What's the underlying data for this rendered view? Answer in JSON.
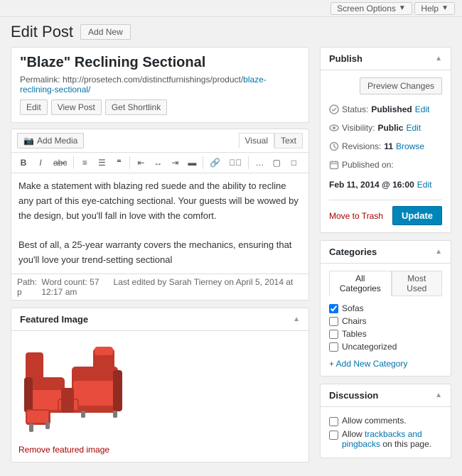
{
  "topBar": {
    "screenOptions": "Screen Options",
    "screenOptionsChevron": "▼",
    "help": "Help",
    "helpChevron": "▼"
  },
  "header": {
    "title": "Edit Post",
    "addNew": "Add New"
  },
  "post": {
    "title": "\"Blaze\" Reclining Sectional",
    "permalinkLabel": "Permalink:",
    "permalinkBase": "http://prosetech.com/distinctfurnishings/product/",
    "permalinkSlug": "blaze-reclining-sectional/",
    "editBtn": "Edit",
    "viewPostBtn": "View Post",
    "getShortlinkBtn": "Get Shortlink"
  },
  "editor": {
    "addMediaBtn": "Add Media",
    "addMediaIcon": "🖼",
    "visualTab": "Visual",
    "textTab": "Text",
    "formatButtons": [
      "B",
      "I",
      "ABC",
      "≡",
      "≡",
      "❝",
      "≡",
      "≡",
      "≡",
      "≡",
      "🔗",
      "🔗✗",
      "⊞",
      "–",
      "⊠",
      "⊟"
    ],
    "content": "Make a statement with blazing red suede and the ability to recline any part of this eye-catching sectional. Your guests will be wowed by the design, but you'll fall in love with the comfort.\n\nBest of all, a 25-year warranty covers the mechanics, ensuring that you'll love your trend-setting sectional",
    "pathLabel": "Path: p",
    "wordCount": "Word count: 57",
    "lastEdited": "Last edited by Sarah Tierney on April 5, 2014 at 12:17 am"
  },
  "featuredImage": {
    "title": "Featured Image",
    "removeLink": "Remove featured image"
  },
  "publish": {
    "title": "Publish",
    "previewBtn": "Preview Changes",
    "statusLabel": "Status:",
    "statusValue": "Published",
    "statusEdit": "Edit",
    "visibilityLabel": "Visibility:",
    "visibilityValue": "Public",
    "visibilityEdit": "Edit",
    "revisionsLabel": "Revisions:",
    "revisionsValue": "11",
    "revisionsLink": "Browse",
    "publishedLabel": "Published on:",
    "publishedValue": "Feb 11, 2014 @ 16:00",
    "publishedEdit": "Edit",
    "moveToTrash": "Move to Trash",
    "updateBtn": "Update"
  },
  "categories": {
    "title": "Categories",
    "allTab": "All Categories",
    "mostUsedTab": "Most Used",
    "items": [
      {
        "label": "Sofas",
        "checked": true
      },
      {
        "label": "Chairs",
        "checked": false
      },
      {
        "label": "Tables",
        "checked": false
      },
      {
        "label": "Uncategorized",
        "checked": false
      }
    ],
    "addNewLink": "+ Add New Category"
  },
  "discussion": {
    "title": "Discussion",
    "allowComments": "Allow comments.",
    "allowTrackbacksPart1": "Allow ",
    "allowTrackbacksLink": "trackbacks and pingbacks",
    "allowTrackbacksPart2": " on this page."
  }
}
